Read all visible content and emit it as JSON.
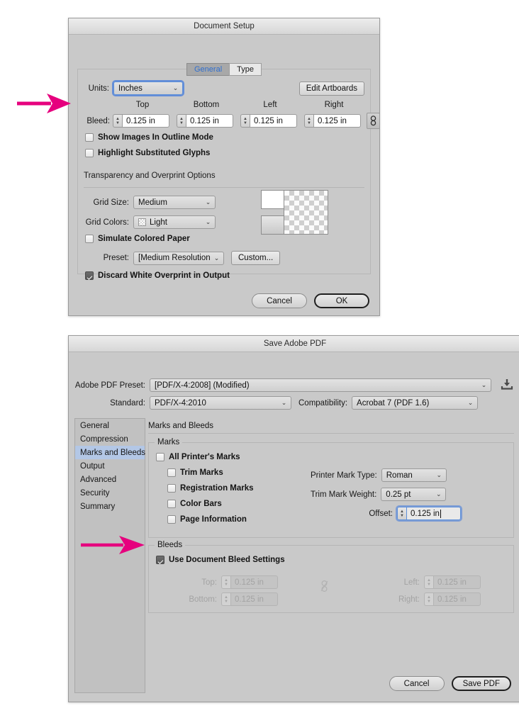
{
  "colors": {
    "annotation_magenta": "#E6007E",
    "dialog_bg": "#C9C9C9",
    "selection_blue": "#B3C7E6",
    "tab_active_text": "#2F6FD0"
  },
  "document_setup": {
    "title": "Document Setup",
    "tabs": [
      {
        "label": "General",
        "selected": true
      },
      {
        "label": "Type",
        "selected": false
      }
    ],
    "units": {
      "label": "Units:",
      "value": "Inches"
    },
    "edit_artboards_button": "Edit Artboards",
    "bleed": {
      "label": "Bleed:",
      "column_headers": [
        "Top",
        "Bottom",
        "Left",
        "Right"
      ],
      "values": [
        "0.125 in",
        "0.125 in",
        "0.125 in",
        "0.125 in"
      ],
      "link_icon": "chain-link-icon"
    },
    "checkboxes": [
      {
        "label": "Show Images In Outline Mode",
        "checked": false
      },
      {
        "label": "Highlight Substituted Glyphs",
        "checked": false
      }
    ],
    "transparency": {
      "section_title": "Transparency and Overprint Options",
      "grid_size": {
        "label": "Grid Size:",
        "value": "Medium"
      },
      "grid_colors": {
        "label": "Grid Colors:",
        "value": "Light",
        "swatch": "checker-swatch-icon"
      },
      "simulate_colored_paper": {
        "label": "Simulate Colored Paper",
        "checked": false
      },
      "preset": {
        "label": "Preset:",
        "value": "[Medium Resolution]"
      },
      "custom_button": "Custom...",
      "discard_white_overprint": {
        "label": "Discard White Overprint in Output",
        "checked": true
      }
    },
    "footer": {
      "cancel": "Cancel",
      "ok": "OK"
    }
  },
  "save_adobe_pdf": {
    "title": "Save Adobe PDF",
    "preset": {
      "label": "Adobe PDF Preset:",
      "value": "[PDF/X-4:2008] (Modified)"
    },
    "save_preset_icon": "save-preset-icon",
    "standard": {
      "label": "Standard:",
      "value": "PDF/X-4:2010"
    },
    "compatibility": {
      "label": "Compatibility:",
      "value": "Acrobat 7 (PDF 1.6)"
    },
    "sidebar": {
      "items": [
        {
          "label": "General",
          "selected": false
        },
        {
          "label": "Compression",
          "selected": false
        },
        {
          "label": "Marks and Bleeds",
          "selected": true
        },
        {
          "label": "Output",
          "selected": false
        },
        {
          "label": "Advanced",
          "selected": false
        },
        {
          "label": "Security",
          "selected": false
        },
        {
          "label": "Summary",
          "selected": false
        }
      ]
    },
    "panel_title": "Marks and Bleeds",
    "marks": {
      "legend": "Marks",
      "all_printers_marks": {
        "label": "All Printer's Marks",
        "checked": false
      },
      "items": [
        {
          "label": "Trim Marks",
          "checked": false
        },
        {
          "label": "Registration Marks",
          "checked": false
        },
        {
          "label": "Color Bars",
          "checked": false
        },
        {
          "label": "Page Information",
          "checked": false
        }
      ],
      "printer_mark_type": {
        "label": "Printer Mark Type:",
        "value": "Roman"
      },
      "trim_mark_weight": {
        "label": "Trim Mark Weight:",
        "value": "0.25 pt"
      },
      "offset": {
        "label": "Offset:",
        "value": "0.125 in",
        "focused": true
      }
    },
    "bleeds": {
      "legend": "Bleeds",
      "use_document_bleed_settings": {
        "label": "Use Document Bleed Settings",
        "checked": true
      },
      "fields": [
        {
          "label": "Top:",
          "value": "0.125 in",
          "disabled": true
        },
        {
          "label": "Bottom:",
          "value": "0.125 in",
          "disabled": true
        },
        {
          "label": "Left:",
          "value": "0.125 in",
          "disabled": true
        },
        {
          "label": "Right:",
          "value": "0.125 in",
          "disabled": true
        }
      ],
      "link_icon": "chain-link-broken-icon"
    },
    "footer": {
      "cancel": "Cancel",
      "save_pdf": "Save PDF"
    }
  },
  "annotations": [
    {
      "name": "arrow-to-bleed-row",
      "color": "#E6007E"
    },
    {
      "name": "arrow-to-use-document-bleed-settings",
      "color": "#E6007E"
    }
  ]
}
